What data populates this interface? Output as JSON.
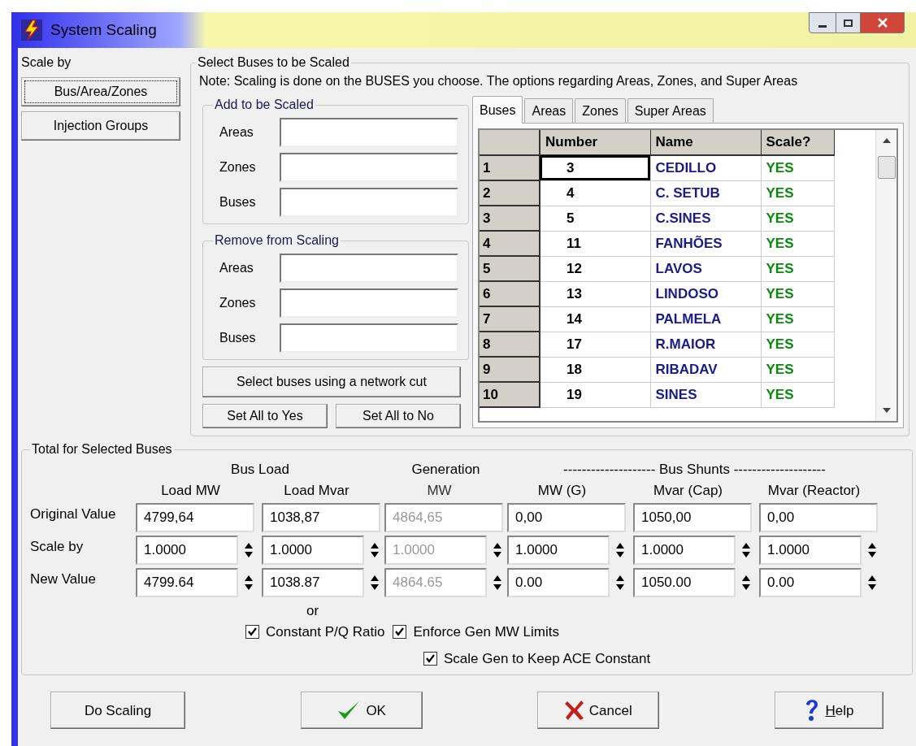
{
  "window": {
    "title": "System Scaling"
  },
  "scale_by": {
    "label": "Scale by",
    "options": [
      {
        "label": "Bus/Area/Zones",
        "selected": true
      },
      {
        "label": "Injection Groups",
        "selected": false
      }
    ]
  },
  "select_buses": {
    "title": "Select Buses to be Scaled",
    "note": "Note: Scaling is done on the BUSES you choose.  The options regarding Areas, Zones, and Super Areas",
    "add_group": {
      "title": "Add to be Scaled",
      "fields": [
        {
          "label": "Areas"
        },
        {
          "label": "Zones"
        },
        {
          "label": "Buses"
        }
      ]
    },
    "remove_group": {
      "title": "Remove from Scaling",
      "fields": [
        {
          "label": "Areas"
        },
        {
          "label": "Zones"
        },
        {
          "label": "Buses"
        }
      ]
    },
    "network_cut_button": "Select buses using a network cut",
    "set_buttons": [
      "Set All to Yes",
      "Set All to No"
    ],
    "tabs": [
      {
        "label": "Buses",
        "selected": true
      },
      {
        "label": "Areas",
        "selected": false
      },
      {
        "label": "Zones",
        "selected": false
      },
      {
        "label": "Super Areas",
        "selected": false
      }
    ],
    "table": {
      "columns": [
        "Number",
        "Name",
        "Scale?"
      ],
      "rows": [
        {
          "index": "1",
          "number": "3",
          "name": "CEDILLO",
          "scale": "YES",
          "selected": true
        },
        {
          "index": "2",
          "number": "4",
          "name": "C. SETUB",
          "scale": "YES",
          "selected": false
        },
        {
          "index": "3",
          "number": "5",
          "name": "C.SINES",
          "scale": "YES",
          "selected": false
        },
        {
          "index": "4",
          "number": "11",
          "name": "FANHÕES",
          "scale": "YES",
          "selected": false
        },
        {
          "index": "5",
          "number": "12",
          "name": "LAVOS",
          "scale": "YES",
          "selected": false
        },
        {
          "index": "6",
          "number": "13",
          "name": "LINDOSO",
          "scale": "YES",
          "selected": false
        },
        {
          "index": "7",
          "number": "14",
          "name": "PALMELA",
          "scale": "YES",
          "selected": false
        },
        {
          "index": "8",
          "number": "17",
          "name": "R.MAIOR",
          "scale": "YES",
          "selected": false
        },
        {
          "index": "9",
          "number": "18",
          "name": "RIBADAV",
          "scale": "YES",
          "selected": false
        },
        {
          "index": "10",
          "number": "19",
          "name": "SINES",
          "scale": "YES",
          "selected": false
        }
      ]
    }
  },
  "totals": {
    "title": "Total for Selected Buses",
    "row_labels": [
      "Original Value",
      "Scale by",
      "New Value"
    ],
    "groups": [
      {
        "title": "Bus Load",
        "columns": [
          {
            "label": "Load MW",
            "disabled": false,
            "original": "4799,64",
            "scale": "1.0000",
            "new": "4799.64"
          },
          {
            "label": "Load Mvar",
            "disabled": false,
            "original": "1038,87",
            "scale": "1.0000",
            "new": "1038.87"
          }
        ]
      },
      {
        "title": "Generation",
        "columns": [
          {
            "label": "MW",
            "disabled": true,
            "original": "4864,65",
            "scale": "1.0000",
            "new": "4864.65"
          }
        ]
      },
      {
        "title": "-------------------- Bus Shunts --------------------",
        "columns": [
          {
            "label": "MW (G)",
            "disabled": false,
            "original": "0,00",
            "scale": "1.0000",
            "new": "0.00"
          },
          {
            "label": "Mvar (Cap)",
            "disabled": false,
            "original": "1050,00",
            "scale": "1.0000",
            "new": "1050.00"
          },
          {
            "label": "Mvar (Reactor)",
            "disabled": false,
            "original": "0,00",
            "scale": "1.0000",
            "new": "0.00"
          }
        ]
      }
    ],
    "or_label": "or",
    "checkboxes": [
      {
        "label": "Constant P/Q Ratio",
        "checked": true
      },
      {
        "label": "Enforce Gen MW Limits",
        "checked": true
      },
      {
        "label": "Scale Gen to Keep ACE Constant",
        "checked": true
      }
    ]
  },
  "buttons": [
    {
      "kind": "plain",
      "label": "Do Scaling"
    },
    {
      "kind": "ok",
      "label": "OK"
    },
    {
      "kind": "cancel",
      "label": "Cancel"
    },
    {
      "kind": "help",
      "label": "Help"
    }
  ]
}
